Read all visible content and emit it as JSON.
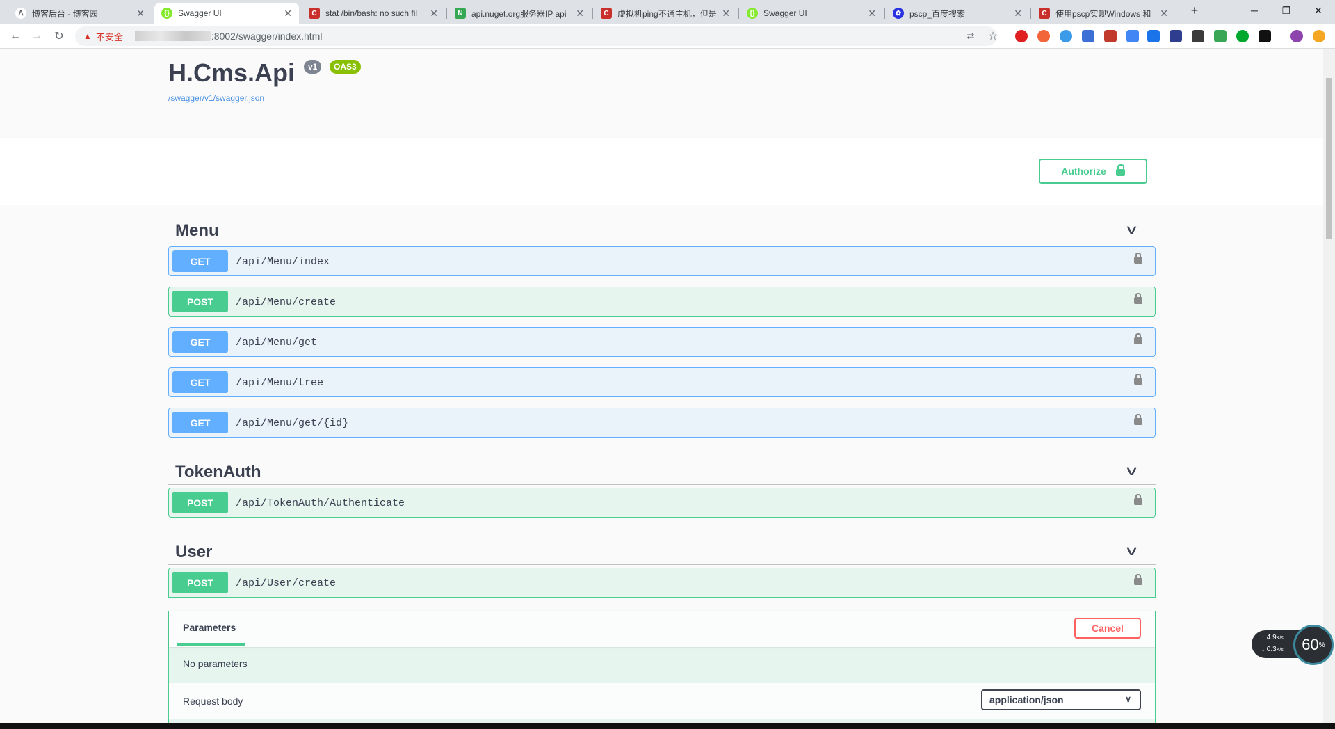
{
  "browser": {
    "tabs": [
      {
        "label": "博客后台 - 博客园",
        "color": "#5f6368"
      },
      {
        "label": "Swagger UI",
        "color": "#85ea2d"
      },
      {
        "label": "stat /bin/bash: no such fil",
        "color": "#c9302c"
      },
      {
        "label": "api.nuget.org服务器IP api",
        "color": "#34a853"
      },
      {
        "label": "虚拟机ping不通主机，但是",
        "color": "#c9302c"
      },
      {
        "label": "Swagger UI",
        "color": "#85ea2d"
      },
      {
        "label": "pscp_百度搜索",
        "color": "#2932e1"
      },
      {
        "label": "使用pscp实现Windows 和",
        "color": "#c9302c"
      }
    ],
    "security_label": "不安全",
    "url_suffix": ":8002/swagger/index.html",
    "new_tab": "+",
    "minimize": "─",
    "restore": "❐",
    "close": "✕"
  },
  "swagger": {
    "title": "H.Cms.Api",
    "version_badge": "v1",
    "oas_badge": "OAS3",
    "spec_link": "/swagger/v1/swagger.json",
    "authorize_label": "Authorize",
    "tags": [
      {
        "name": "Menu"
      },
      {
        "name": "TokenAuth"
      },
      {
        "name": "User"
      }
    ],
    "operations": [
      {
        "method": "GET",
        "path": "/api/Menu/index"
      },
      {
        "method": "POST",
        "path": "/api/Menu/create"
      },
      {
        "method": "GET",
        "path": "/api/Menu/get"
      },
      {
        "method": "GET",
        "path": "/api/Menu/tree"
      },
      {
        "method": "GET",
        "path": "/api/Menu/get/{id}"
      },
      {
        "method": "POST",
        "path": "/api/TokenAuth/Authenticate"
      },
      {
        "method": "POST",
        "path": "/api/User/create"
      }
    ],
    "expanded": {
      "params_tab": "Parameters",
      "cancel_label": "Cancel",
      "no_params": "No parameters",
      "request_body_label": "Request body",
      "content_type": "application/json"
    }
  },
  "speed_widget": {
    "up": "4.9",
    "down": "0.3",
    "unit": "K/s",
    "value": "60",
    "suffix": "%"
  }
}
